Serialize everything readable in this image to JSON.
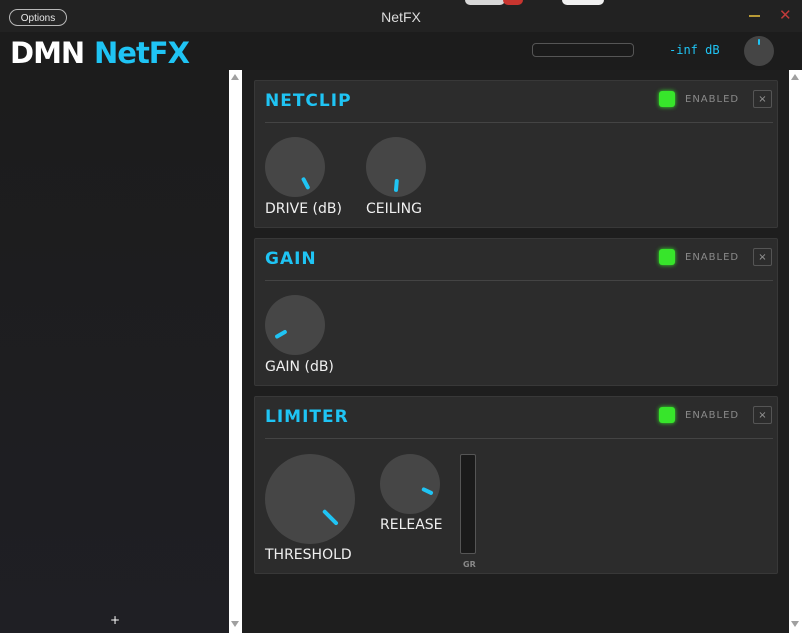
{
  "window": {
    "title": "NetFX",
    "options_label": "Options"
  },
  "header": {
    "logo_brand": "DMN",
    "logo_product": "NetFX",
    "level_readout": "-inf dB"
  },
  "sidebar": {
    "add_label": "+"
  },
  "colors": {
    "accent": "#1fc4f4",
    "led_on": "#37e52b",
    "close": "#c03a3a",
    "minimize": "#b89a36"
  },
  "modules": [
    {
      "title": "NETCLIP",
      "enabled_label": "ENABLED",
      "close_label": "×",
      "knobs": [
        {
          "label": "DRIVE (dB)"
        },
        {
          "label": "CEILING"
        }
      ]
    },
    {
      "title": "GAIN",
      "enabled_label": "ENABLED",
      "close_label": "×",
      "knobs": [
        {
          "label": "GAIN (dB)"
        }
      ]
    },
    {
      "title": "LIMITER",
      "enabled_label": "ENABLED",
      "close_label": "×",
      "knobs": [
        {
          "label": "THRESHOLD"
        },
        {
          "label": "RELEASE"
        }
      ],
      "meter_label": "GR"
    }
  ]
}
